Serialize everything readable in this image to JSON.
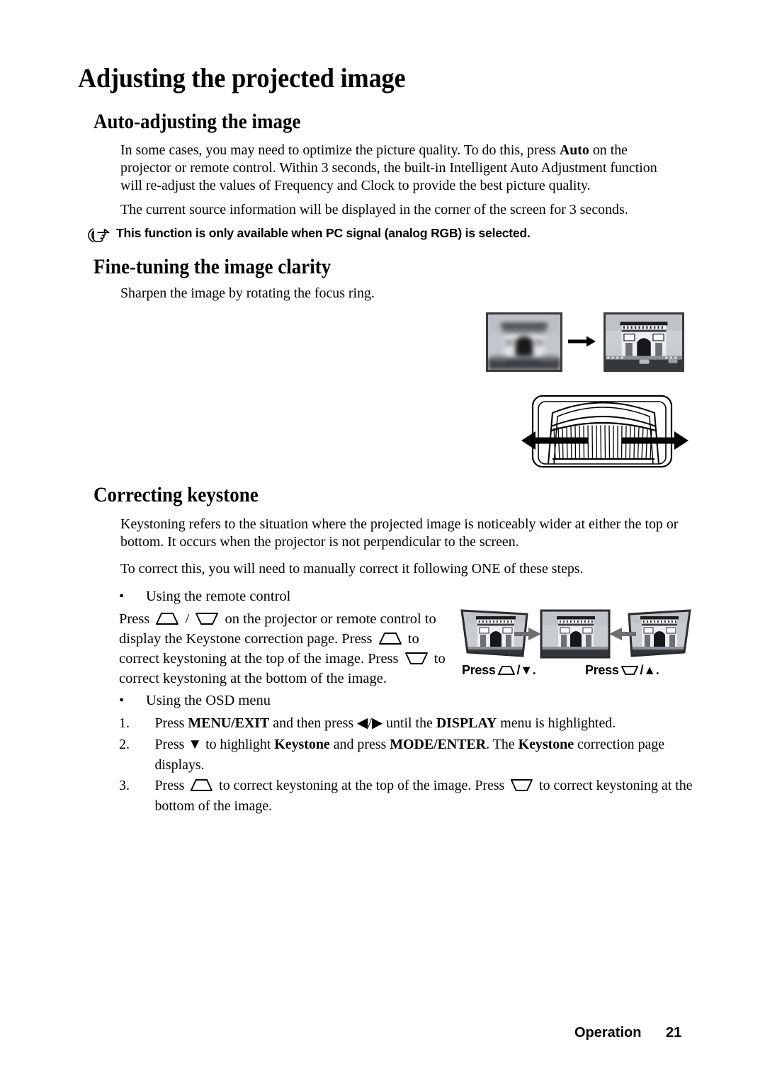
{
  "page": {
    "title": "Adjusting the projected image",
    "footer": {
      "section": "Operation",
      "page_number": "21"
    }
  },
  "sections": {
    "auto_adjust": {
      "heading": "Auto-adjusting the image",
      "paragraph_1_a": "In some cases, you may need to optimize the picture quality. To do this, press ",
      "paragraph_1_bold": "Auto",
      "paragraph_1_b": " on the projector or remote control. Within 3 seconds, the built-in Intelligent Auto Adjustment function will re-adjust the values of Frequency and Clock to provide the best picture quality.",
      "paragraph_2": "The current source information will be displayed in the corner of the screen for 3 seconds.",
      "note": {
        "icon": "pointing-hand-icon",
        "text": "This function is only available when PC signal (analog RGB) is selected."
      }
    },
    "fine_tuning": {
      "heading": "Fine-tuning the image clarity",
      "paragraph": "Sharpen the image by rotating the focus ring.",
      "figure_focus": {
        "blurry_image_alt": "Blurred projected image of the Arc de Triomphe",
        "sharp_image_alt": "Sharp projected image of the Arc de Triomphe",
        "arrow": "arrow-right-icon"
      },
      "figure_ring": {
        "alt": "Projector lens focus ring with left and right rotation arrows"
      }
    },
    "keystone": {
      "heading": "Correcting keystone",
      "paragraph_1": "Keystoning refers to the situation where the projected image is noticeably wider at either the top or bottom. It occurs when the projector is not perpendicular to the screen.",
      "paragraph_2": "To correct this, you will need to manually correct it following ONE of these steps.",
      "bullet_remote": "Using the remote control",
      "remote_paragraph": {
        "t1": "Press ",
        "icon_1": "keystone-up-icon",
        "t2": " / ",
        "icon_2": "keystone-down-icon",
        "t3": " on the projector or remote control to display the Keystone correction page. Press ",
        "icon_3": "keystone-up-icon",
        "t4": " to correct keystoning at the top of the image. Press ",
        "icon_4": "keystone-down-icon",
        "t5": " to correct keystoning at the bottom of the image."
      },
      "bullet_osd": "Using the OSD menu",
      "steps": [
        {
          "number": "1.",
          "t1": "Press ",
          "b1": "MENU/EXIT",
          "t2": " and then press ",
          "arrows": "◀/▶",
          "t3": " until the ",
          "b2": "DISPLAY",
          "t4": " menu is highlighted."
        },
        {
          "number": "2.",
          "t1": "Press ",
          "arrow_down": "▼",
          "t2": " to highlight ",
          "b1": "Keystone",
          "t3": " and press ",
          "b2": "MODE/ENTER",
          "t4": ". The ",
          "b3": "Keystone",
          "t5": " correction page displays."
        },
        {
          "number": "3.",
          "t1": "Press ",
          "icon_1": "keystone-up-icon",
          "t2": " to correct keystoning at the top of the image. Press ",
          "icon_2": "keystone-down-icon",
          "t3": " to correct keystoning at the bottom of the image."
        }
      ],
      "figure_keystone": {
        "left_image_alt": "Projected image wider at the top",
        "center_image_alt": "Correctly rectangular projected image",
        "right_image_alt": "Projected image wider at the bottom",
        "caption_left_prefix": "Press",
        "caption_left_icon_a": "keystone-up-icon",
        "caption_left_sep": "/",
        "caption_left_icon_b": "▼",
        "caption_left_suffix": ".",
        "caption_right_prefix": "Press",
        "caption_right_icon_a": "keystone-down-icon",
        "caption_right_sep": "/",
        "caption_right_icon_b": "▲",
        "caption_right_suffix": "."
      }
    }
  },
  "colors": {
    "text": "#000000",
    "background": "#ffffff",
    "photo_frame": "#3a3a3a",
    "arrow_gray": "#6e6e6e"
  }
}
